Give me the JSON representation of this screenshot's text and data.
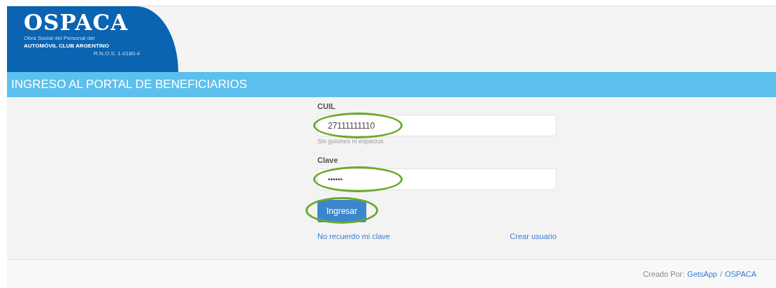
{
  "logo": {
    "name": "OSPACA",
    "subtitle": "Obra Social del Personal del",
    "club": "AUTOMÓVIL CLUB ARGENTINO",
    "registry": "R.N.O.S. 1-0180-4"
  },
  "banner": {
    "title": "INGRESO AL PORTAL DE BENEFICIARIOS"
  },
  "form": {
    "fields": [
      {
        "label": "CUIL",
        "value": "27111111110",
        "help": "Sin guiones ni espacios",
        "kind": "text",
        "highlighted": true
      },
      {
        "label": "Clave",
        "value": "••••••",
        "kind": "password",
        "highlighted": true
      }
    ],
    "submit": {
      "label": "Ingresar",
      "highlighted": true
    },
    "links": [
      "No recuerdo mi clave",
      "Crear usuario"
    ]
  },
  "footer": {
    "prefix": "Creado Por:",
    "links": [
      "GetsApp",
      "OSPACA"
    ],
    "separator": "/"
  }
}
